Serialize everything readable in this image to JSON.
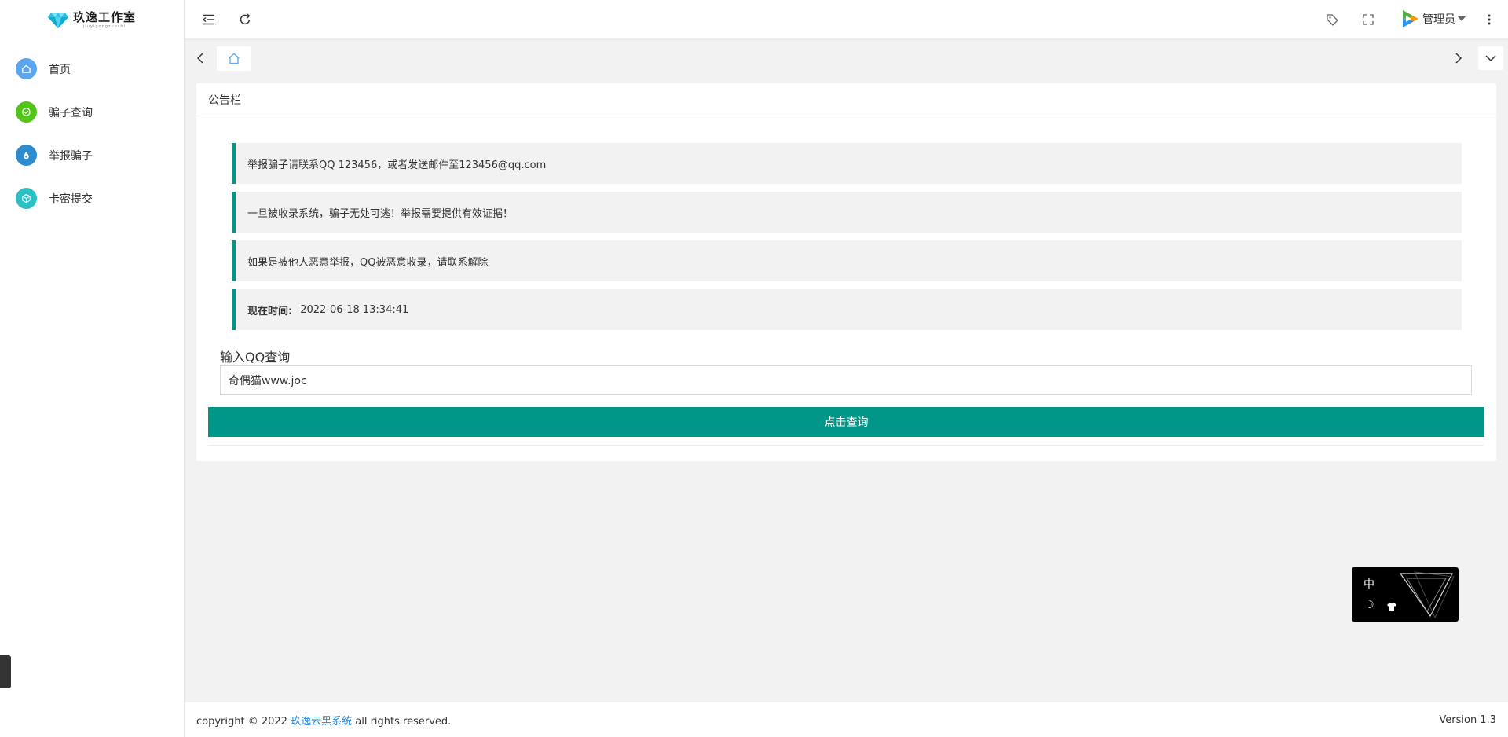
{
  "logo": {
    "text": "玖逸工作室",
    "sub": "jiuyigongzuoshi"
  },
  "sidebar": {
    "items": [
      {
        "label": "首页",
        "color": "#5aa6f0",
        "icon": "home-icon"
      },
      {
        "label": "骗子查询",
        "color": "#52c41a",
        "icon": "check-shield-icon"
      },
      {
        "label": "举报骗子",
        "color": "#2d8ccf",
        "icon": "drop-icon"
      },
      {
        "label": "卡密提交",
        "color": "#2bc0c4",
        "icon": "cube-icon"
      }
    ]
  },
  "header": {
    "admin_name": "管理员"
  },
  "card": {
    "title": "公告栏",
    "notices": [
      "举报骗子请联系QQ 123456，或者发送邮件至123456@qq.com",
      "一旦被收录系统，骗子无处可逃！举报需要提供有效证据！",
      "如果是被他人恶意举报，QQ被恶意收录，请联系解除"
    ],
    "time_label": "现在时间:",
    "time_value": "2022-06-18 13:34:41",
    "query_label": "输入QQ查询",
    "query_value": "奇偶猫www.joc",
    "query_button": "点击查询"
  },
  "widget": {
    "lang": "中",
    "moon": "☽"
  },
  "footer": {
    "prefix": "copyright © 2022",
    "link": "玖逸云黑系统",
    "suffix": "all rights reserved.",
    "version": "Version 1.3"
  },
  "colors": {
    "accent": "#009688",
    "link": "#1e88e5"
  }
}
